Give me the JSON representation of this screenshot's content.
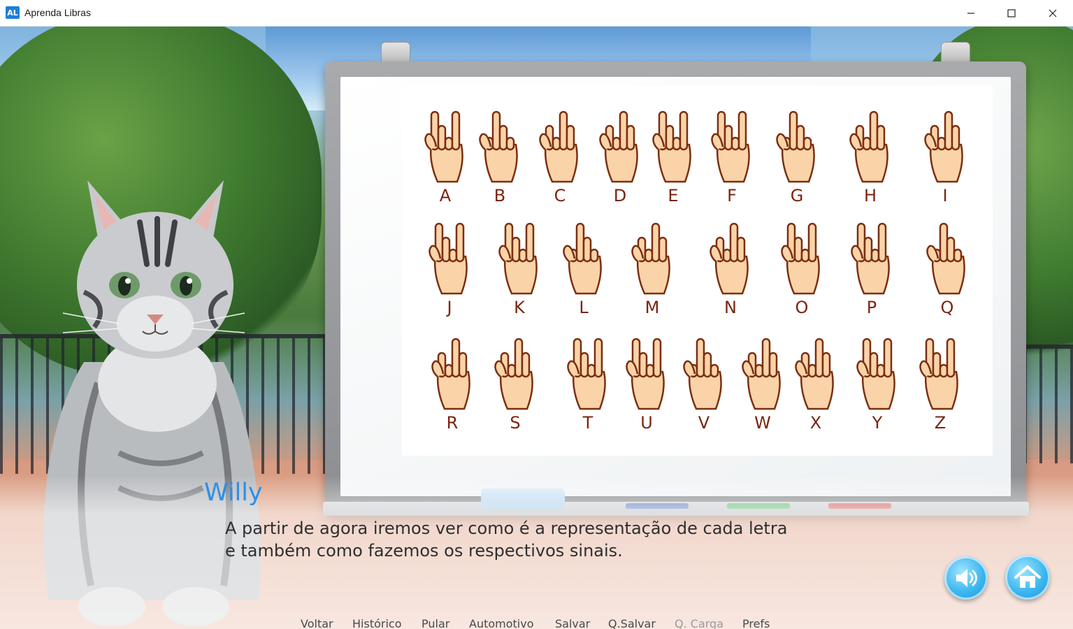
{
  "window": {
    "title": "Aprenda Libras",
    "icon_text": "AL",
    "controls": [
      "minimize",
      "maximize",
      "close"
    ]
  },
  "whiteboard": {
    "letters": [
      "A",
      "B",
      "C",
      "D",
      "E",
      "F",
      "G",
      "H",
      "I",
      "J",
      "K",
      "L",
      "M",
      "N",
      "O",
      "P",
      "Q",
      "R",
      "S",
      "T",
      "U",
      "V",
      "W",
      "X",
      "Y",
      "Z"
    ]
  },
  "dialogue": {
    "speaker": "Willy",
    "line1": "A partir de agora iremos ver como é a representação de cada letra",
    "line2": "e também como fazemos os respectivos sinais."
  },
  "buttons": {
    "audio_icon": "speaker-icon",
    "home_icon": "home-icon"
  },
  "quick_menu": {
    "back": "Voltar",
    "history": "Histórico",
    "skip": "Pular",
    "auto": "Automotivo",
    "save": "Salvar",
    "quick_save": "Q.Salvar",
    "quick_load": "Q. Carga",
    "prefs": "Prefs"
  },
  "colors": {
    "speaker_name": "#2e8fe6",
    "letter": "#7a2510",
    "hand_fill": "#fbd3a9",
    "hand_stroke": "#7a2f10",
    "button_blue": "#3bb6ef"
  }
}
